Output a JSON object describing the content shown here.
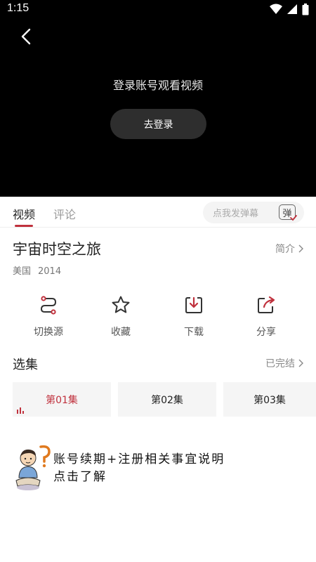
{
  "status_bar": {
    "time": "1:15"
  },
  "player": {
    "login_prompt": "登录账号观看视频",
    "login_button": "去登录"
  },
  "tabs": [
    {
      "label": "视频",
      "active": true
    },
    {
      "label": "评论",
      "active": false
    }
  ],
  "danmu": {
    "placeholder": "点我发弹幕",
    "toggle_label": "弹"
  },
  "show": {
    "title": "宇宙时空之旅",
    "intro_label": "简介",
    "region": "美国",
    "year": "2014"
  },
  "actions": [
    {
      "label": "切换源",
      "icon": "switch-source-icon"
    },
    {
      "label": "收藏",
      "icon": "star-icon"
    },
    {
      "label": "下载",
      "icon": "download-icon"
    },
    {
      "label": "分享",
      "icon": "share-icon"
    }
  ],
  "episodes": {
    "heading": "选集",
    "status": "已完结",
    "items": [
      {
        "label": "第01集",
        "active": true
      },
      {
        "label": "第02集",
        "active": false
      },
      {
        "label": "第03集",
        "active": false
      }
    ]
  },
  "notice": {
    "line1": "账号续期+注册相关事宜说明",
    "line2": "点击了解"
  },
  "colors": {
    "accent": "#c0313d",
    "player_bg": "#000000"
  }
}
